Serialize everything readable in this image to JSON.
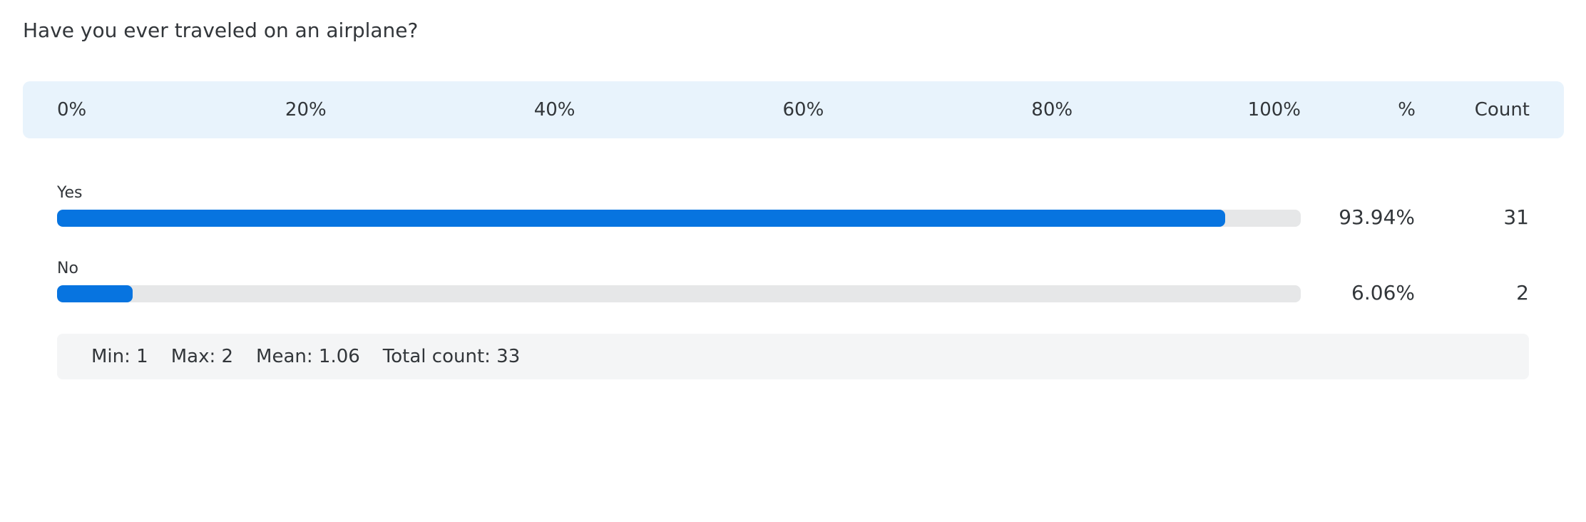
{
  "question": "Have you ever traveled on an airplane?",
  "header": {
    "ticks": [
      "0%",
      "20%",
      "40%",
      "60%",
      "80%",
      "100%"
    ],
    "pct_label": "%",
    "count_label": "Count"
  },
  "chart_data": {
    "type": "bar",
    "orientation": "horizontal",
    "title": "Have you ever traveled on an airplane?",
    "categories": [
      "Yes",
      "No"
    ],
    "values_percent": [
      93.94,
      6.06
    ],
    "counts": [
      31,
      2
    ],
    "xlim": [
      0,
      100
    ],
    "x_ticks": [
      "0%",
      "20%",
      "40%",
      "60%",
      "80%",
      "100%"
    ],
    "bar_color": "#0774e0",
    "track_color": "#e6e7e8"
  },
  "rows": [
    {
      "label": "Yes",
      "percent": 93.94,
      "percent_text": "93.94%",
      "count": "31"
    },
    {
      "label": "No",
      "percent": 6.06,
      "percent_text": "6.06%",
      "count": "2"
    }
  ],
  "stats": {
    "min": "Min: 1",
    "max": "Max: 2",
    "mean": "Mean: 1.06",
    "total": "Total count: 33"
  },
  "colors": {
    "header_bg": "#e8f3fc",
    "bar": "#0774e0",
    "track": "#e6e7e8",
    "stats_bg": "#f4f5f6",
    "text": "#32363a"
  }
}
